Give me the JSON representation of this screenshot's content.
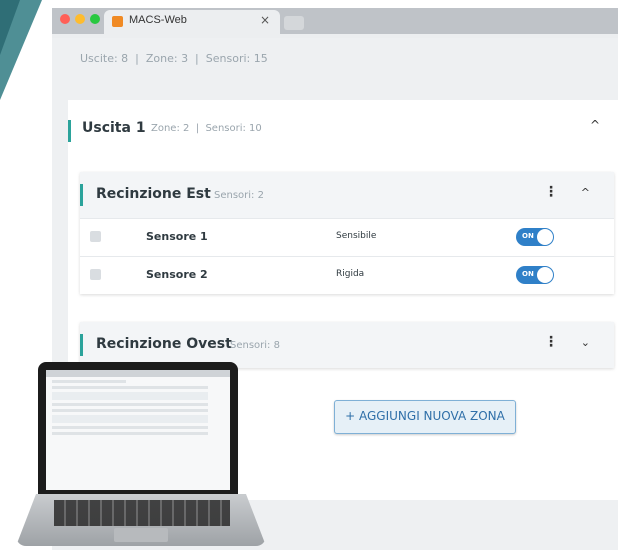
{
  "browser": {
    "tab_title": "MACS-Web",
    "tab_close": "×",
    "traffic_colors": [
      "#ff5f57",
      "#febc2e",
      "#28c840"
    ],
    "favicon_color": "#f08a24"
  },
  "summary": "Uscite: 8  |  Zone: 3  |  Sensori: 15",
  "uscita": {
    "title": "Uscita 1",
    "meta": "Zone: 2  |  Sensori: 10",
    "chevron": "^"
  },
  "zones": [
    {
      "title": "Recinzione Est",
      "meta": "Sensori: 2",
      "menu": "⋮",
      "chevron": "^",
      "sensors": [
        {
          "name": "Sensore 1",
          "type": "Sensibile",
          "toggle": "ON"
        },
        {
          "name": "Sensore 2",
          "type": "Rigida",
          "toggle": "ON"
        }
      ]
    },
    {
      "title": "Recinzione Ovest",
      "meta": "Sensori: 8",
      "menu": "⋮",
      "chevron": "⌄"
    }
  ],
  "add_zone_label": "+ AGGIUNGI NUOVA ZONA",
  "accent": {
    "teal": "#2ba39b",
    "toggle": "#2f80c8",
    "button_text": "#2f6fa8"
  }
}
